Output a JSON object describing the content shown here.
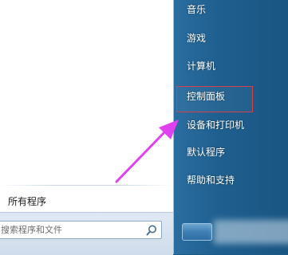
{
  "left_pane": {
    "all_programs_label": "所有程序",
    "search": {
      "placeholder": "搜索程序和文件"
    }
  },
  "right_pane": {
    "items": [
      {
        "label": "音乐"
      },
      {
        "label": "游戏"
      },
      {
        "label": "计算机"
      },
      {
        "label": "控制面板"
      },
      {
        "label": "设备和打印机"
      },
      {
        "label": "默认程序"
      },
      {
        "label": "帮助和支持"
      }
    ]
  },
  "colors": {
    "right_pane": "#1f5f8f",
    "highlight_border": "#d6414f",
    "arrow": "#e040f0"
  },
  "icons": {
    "search": "magnifier-icon",
    "annotation_arrow": "arrow-icon"
  }
}
